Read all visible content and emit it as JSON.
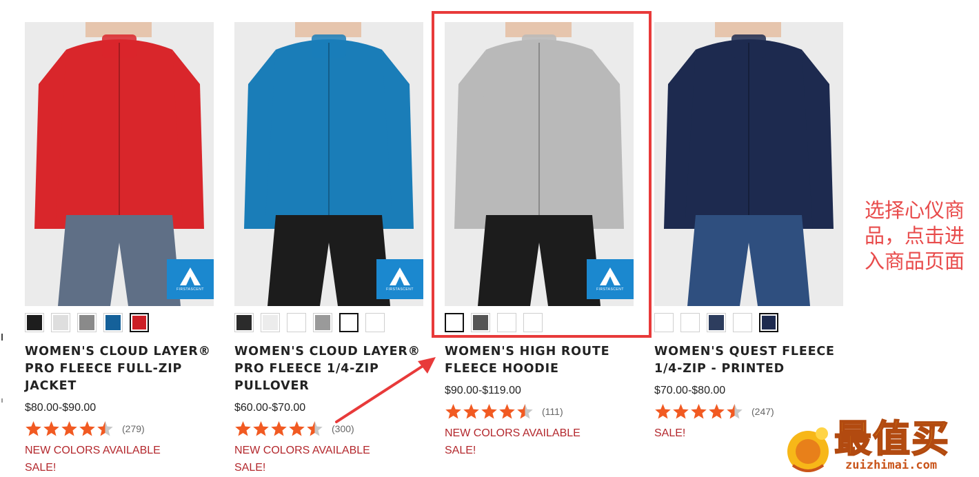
{
  "products": [
    {
      "name": "WOMEN'S CLOUD LAYER® PRO FLEECE FULL-ZIP JACKET",
      "price": "$80.00-$90.00",
      "rating": 4.5,
      "review_count": "(279)",
      "promos": [
        "NEW COLORS AVAILABLE",
        "SALE!"
      ],
      "badge_text": "FIRSTASCENT",
      "jacket_color": "#d9262b",
      "pants_color": "#5f6f86",
      "swatches": [
        {
          "color": "#1d1d1d",
          "selected": false
        },
        {
          "color": "#dedede",
          "selected": false
        },
        {
          "color": "#8a8a8a",
          "selected": false
        },
        {
          "color": "#15619a",
          "selected": false
        },
        {
          "color": "#cc1f26",
          "selected": true
        }
      ]
    },
    {
      "name": "WOMEN'S CLOUD LAYER® PRO FLEECE 1/4-ZIP PULLOVER",
      "price": "$60.00-$70.00",
      "rating": 4.5,
      "review_count": "(300)",
      "promos": [
        "NEW COLORS AVAILABLE",
        "SALE!"
      ],
      "badge_text": "FIRSTASCENT",
      "jacket_color": "#1a7db8",
      "pants_color": "#1c1c1c",
      "swatches": [
        {
          "color": "#2b2b2b",
          "selected": false
        },
        {
          "color": "#ececec",
          "selected": false
        },
        {
          "color": "#ffffff",
          "selected": false
        },
        {
          "color": "#9a9a9a",
          "selected": false
        },
        {
          "color": "#ffffff",
          "selected": true
        },
        {
          "color": "#ffffff",
          "selected": false
        }
      ]
    },
    {
      "name": "WOMEN'S HIGH ROUTE FLEECE HOODIE",
      "price": "$90.00-$119.00",
      "rating": 4.5,
      "review_count": "(111)",
      "promos": [
        "NEW COLORS AVAILABLE",
        "SALE!"
      ],
      "badge_text": "FIRSTASCENT",
      "jacket_color": "#b9b9b9",
      "pants_color": "#1c1c1c",
      "swatches": [
        {
          "color": "#ffffff",
          "selected": true
        },
        {
          "color": "#555555",
          "selected": false
        },
        {
          "color": "#ffffff",
          "selected": false
        },
        {
          "color": "#ffffff",
          "selected": false
        }
      ]
    },
    {
      "name": "WOMEN'S QUEST FLEECE 1/4-ZIP - PRINTED",
      "price": "$70.00-$80.00",
      "rating": 4.5,
      "review_count": "(247)",
      "promos": [
        "SALE!"
      ],
      "badge_text": "",
      "jacket_color": "#1d2a4f",
      "pants_color": "#2f4f7f",
      "swatches": [
        {
          "color": "#ffffff",
          "selected": false
        },
        {
          "color": "#ffffff",
          "selected": false
        },
        {
          "color": "#2d3d5e",
          "selected": false
        },
        {
          "color": "#ffffff",
          "selected": false
        },
        {
          "color": "#1d2a4f",
          "selected": true
        }
      ]
    }
  ],
  "annotation": {
    "text": "选择心仪商品，点击进入商品页面",
    "lines": [
      "选择心仪商",
      "品，点击进",
      "入商品页面"
    ],
    "color": "#e84b4b"
  },
  "watermark": {
    "title": "最值买",
    "domain": "zuizhimai.com"
  },
  "colors": {
    "star": "#f15a22",
    "star_empty": "#c8c8c8",
    "promo": "#b3272c",
    "highlight": "#e83a3a",
    "badge": "#1b88cf"
  }
}
